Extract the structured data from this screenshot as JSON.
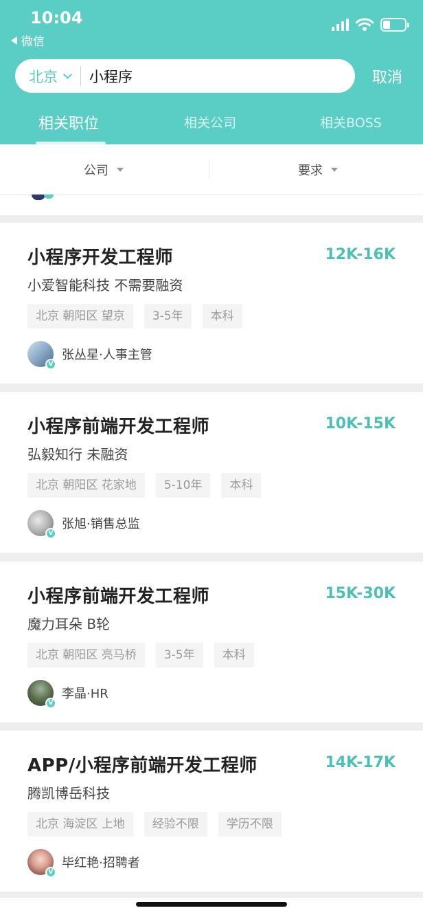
{
  "status_bar": {
    "time": "10:04",
    "back_label": "微信"
  },
  "search": {
    "city": "北京",
    "query": "小程序",
    "cancel_label": "取消"
  },
  "tabs": [
    {
      "label": "相关职位",
      "active": true
    },
    {
      "label": "相关公司",
      "active": false
    },
    {
      "label": "相关BOSS",
      "active": false
    }
  ],
  "filters": [
    {
      "label": "公司"
    },
    {
      "label": "要求"
    }
  ],
  "jobs": [
    {
      "title": "小程序开发工程师",
      "salary": "12K-16K",
      "company": "小爱智能科技 不需要融资",
      "tags": [
        "北京 朝阳区 望京",
        "3-5年",
        "本科"
      ],
      "recruiter": "张丛星·人事主管"
    },
    {
      "title": "小程序前端开发工程师",
      "salary": "10K-15K",
      "company": "弘毅知行 未融资",
      "tags": [
        "北京 朝阳区 花家地",
        "5-10年",
        "本科"
      ],
      "recruiter": "张旭·销售总监"
    },
    {
      "title": "小程序前端开发工程师",
      "salary": "15K-30K",
      "company": "魔力耳朵 B轮",
      "tags": [
        "北京 朝阳区 亮马桥",
        "3-5年",
        "本科"
      ],
      "recruiter": "李晶·HR"
    },
    {
      "title": "APP/小程序前端开发工程师",
      "salary": "14K-17K",
      "company": "腾凯博岳科技",
      "tags": [
        "北京 海淀区 上地",
        "经验不限",
        "学历不限"
      ],
      "recruiter": "毕红艳·招聘者"
    }
  ],
  "verified_badge": "V",
  "colors": {
    "accent": "#5acec4",
    "salary": "#4dbfb5"
  }
}
